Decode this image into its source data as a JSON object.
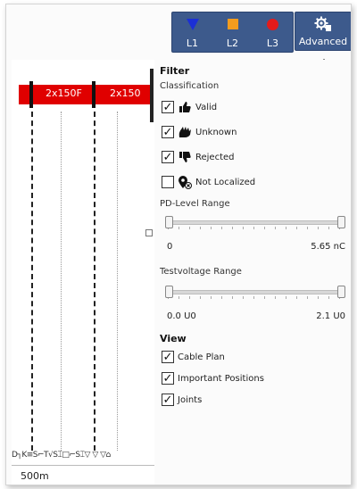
{
  "toolbar": {
    "phases": [
      {
        "label": "L1",
        "shape": "triangle",
        "color": "#1b2fd6"
      },
      {
        "label": "L2",
        "shape": "square",
        "color": "#f39c1e"
      },
      {
        "label": "L3",
        "shape": "circle",
        "color": "#e31b1b"
      }
    ],
    "advanced_label": "Advanced"
  },
  "cable_plan": {
    "segments": [
      "2x150F",
      "2x150"
    ],
    "bar_color": "#e00000",
    "scale_label": "500m",
    "marker_text": "D┐K≡S⌐T√S⌶□⌐S⌶▽  ▽   ▽⌂"
  },
  "filter": {
    "heading": "Filter",
    "classification_label": "Classification",
    "classification": [
      {
        "label": "Valid",
        "checked": true,
        "icon": "thumbs-up-icon"
      },
      {
        "label": "Unknown",
        "checked": true,
        "icon": "wavering-hand-icon"
      },
      {
        "label": "Rejected",
        "checked": true,
        "icon": "thumbs-down-icon"
      },
      {
        "label": "Not Localized",
        "checked": false,
        "icon": "location-off-icon"
      }
    ],
    "pd_level": {
      "label": "PD-Level Range",
      "min_label": "0",
      "max_label": "5.65 nC"
    },
    "testvoltage": {
      "label": "Testvoltage Range",
      "min_label": "0.0 U0",
      "max_label": "2.1 U0"
    }
  },
  "view": {
    "heading": "View",
    "items": [
      {
        "label": "Cable Plan",
        "checked": true
      },
      {
        "label": "Important Positions",
        "checked": true
      },
      {
        "label": "Joints",
        "checked": true
      }
    ]
  },
  "colors": {
    "toolbar_bg": "#3d5a8c",
    "annotation_arrow": "#ffee00"
  }
}
